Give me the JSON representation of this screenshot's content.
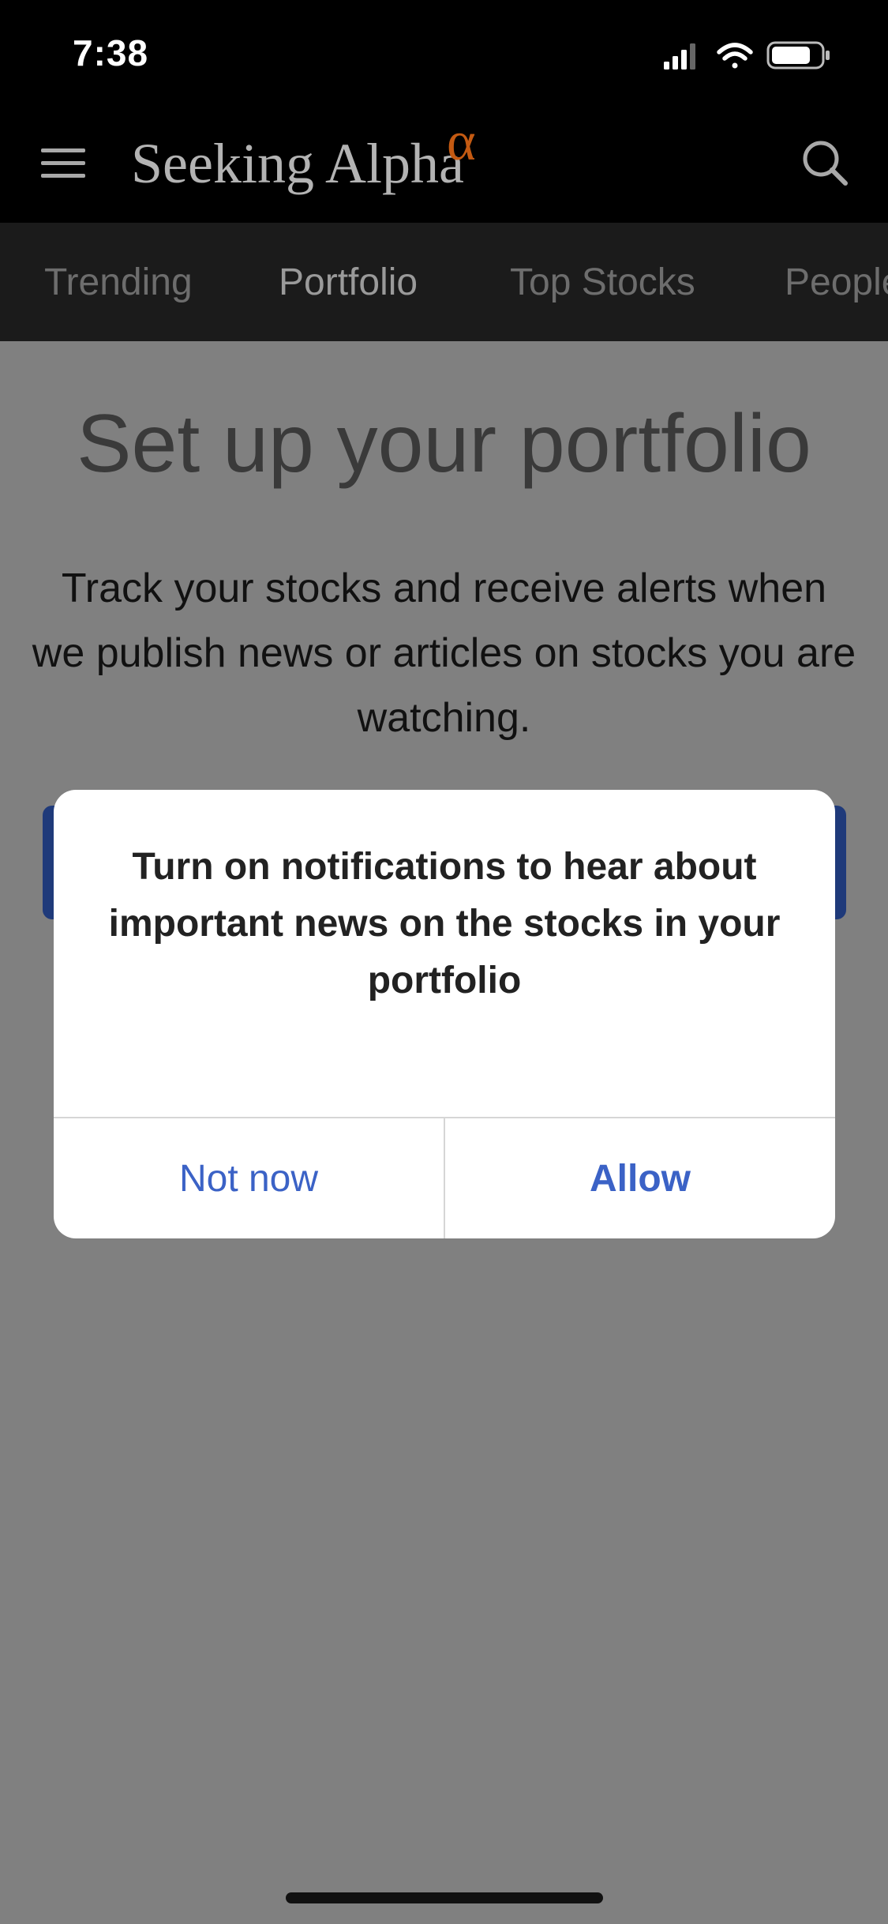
{
  "status_bar": {
    "time": "7:38",
    "icons": [
      "cellular-signal-icon",
      "wifi-icon",
      "battery-icon"
    ]
  },
  "header": {
    "brand": "Seeking Alpha",
    "brand_mark": "α",
    "menu_icon": "hamburger-menu-icon",
    "search_icon": "search-icon"
  },
  "tabs": [
    {
      "label": "Trending",
      "active": false
    },
    {
      "label": "Portfolio",
      "active": true
    },
    {
      "label": "Top Stocks",
      "active": false
    },
    {
      "label": "People",
      "active": false
    }
  ],
  "main": {
    "title": "Set up your portfolio",
    "description": "Track your stocks and receive alerts when we publish news or articles on stocks you are watching."
  },
  "dialog": {
    "message": "Turn on notifications to hear about important news on the stocks in your portfolio",
    "secondary_button": "Not now",
    "primary_button": "Allow"
  },
  "colors": {
    "brand_accent": "#c45a12",
    "dialog_button": "#3b62c6",
    "overlay_gray": "#808080"
  }
}
